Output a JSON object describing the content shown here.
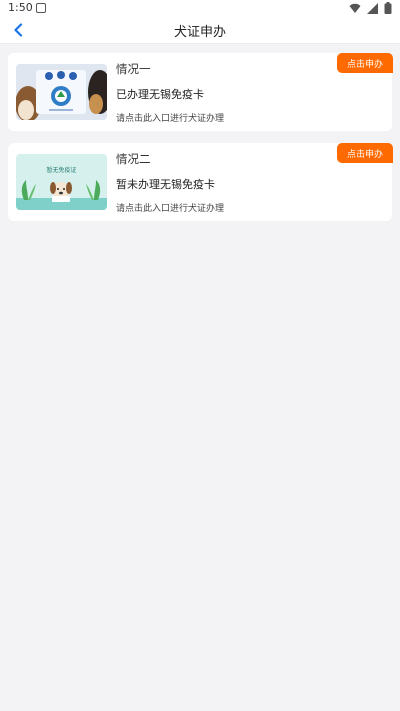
{
  "status_bar": {
    "time": "1:50"
  },
  "header": {
    "title": "犬证申办",
    "back_icon": "chevron-left-icon"
  },
  "cards": [
    {
      "title": "情况一",
      "status": "已办理无锡免疫卡",
      "hint": "请点击此入口进行犬证办理",
      "button": "点击申办",
      "image_icon": "dog-card-photo"
    },
    {
      "title": "情况二",
      "status": "暂未办理无锡免疫卡",
      "hint": "请点击此入口进行犬证办理",
      "button": "点击申办",
      "image_label": "暂无免疫证",
      "image_icon": "dog-illustration"
    }
  ],
  "colors": {
    "accent": "#ff6a00",
    "back": "#1a73e8",
    "background": "#f3f3f6"
  }
}
